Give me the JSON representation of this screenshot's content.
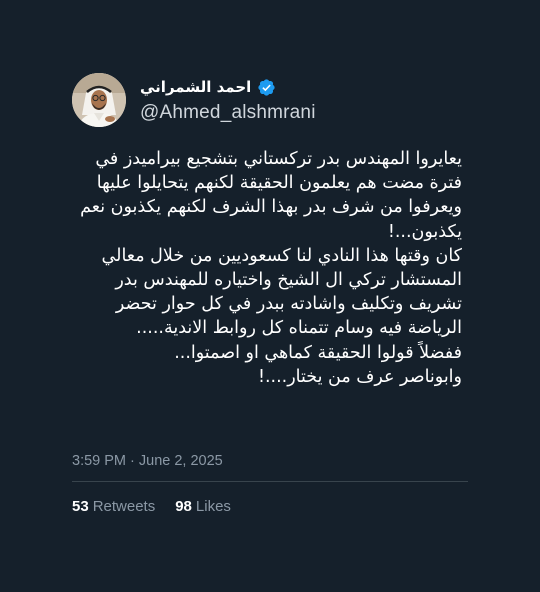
{
  "author": {
    "display_name": "احمد الشمراني",
    "handle": "@Ahmed_alshmrani",
    "verified_icon": "verified-badge-icon",
    "avatar": "profile-photo"
  },
  "tweet": {
    "lines": [
      "يعايروا المهندس بدر تركستاني بتشجيع بيراميدز في",
      "فترة مضت هم يعلمون الحقيقة لكنهم يتحايلوا عليها",
      "ويعرفوا من شرف بدر بهذا الشرف لكنهم يكذبون نعم",
      "يكذبون...!",
      "كان وقتها هذا النادي لنا كسعوديين من خلال معالي",
      "المستشار تركي ال الشيخ واختياره للمهندس بدر",
      "تشريف وتكليف واشادته ببدر في كل حوار تحضر",
      "الرياضة فيه وسام تتمناه كل روابط الاندية.....",
      "ففضلاً قولوا الحقيقة كماهي او اصمتوا...",
      "وابوناصر عرف من يختار....!"
    ],
    "timestamp": "3:59 PM · June 2, 2025"
  },
  "stats": {
    "retweets_count": "53",
    "retweets_label": "Retweets",
    "likes_count": "98",
    "likes_label": "Likes"
  },
  "colors": {
    "background": "#15202b",
    "text": "#ffffff",
    "secondary_text": "#8b98a5",
    "divider": "#38444d",
    "verified": "#1d9bf0"
  }
}
